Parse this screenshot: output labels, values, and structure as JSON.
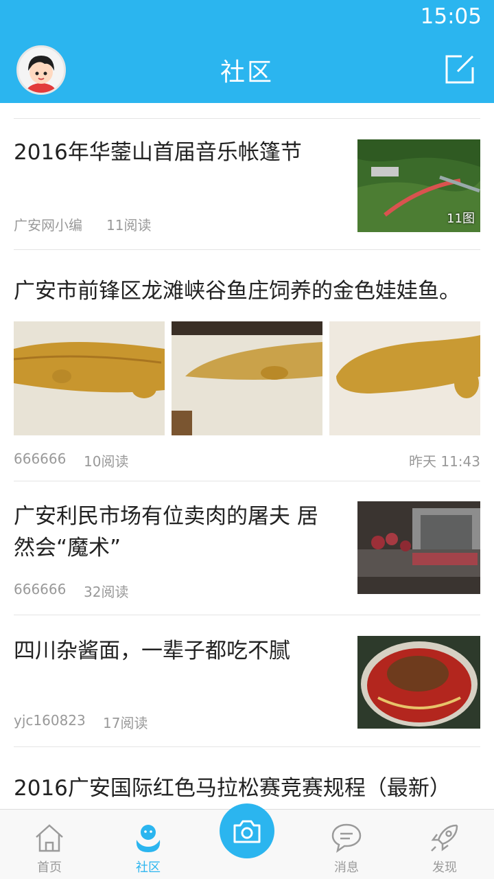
{
  "status_bar": {
    "time": "15:05"
  },
  "header": {
    "title": "社区"
  },
  "posts": [
    {
      "title": "2016年华蓥山首届音乐帐篷节",
      "author": "广安网小编",
      "reads": "11阅读",
      "image_count": "11图"
    },
    {
      "title": "广安市前锋区龙滩峡谷鱼庄饲养的金色娃娃鱼。",
      "author": "666666",
      "reads": "10阅读",
      "time": "昨天 11:43"
    },
    {
      "title_line1": "广安利民市场有位卖肉的屠夫 居",
      "title_line2": "然会“魔术”",
      "author": "666666",
      "reads": "32阅读"
    },
    {
      "title": "四川杂酱面，一辈子都吃不腻",
      "author": "yjc160823",
      "reads": "17阅读"
    },
    {
      "title": "2016广安国际红色马拉松赛竞赛规程（最新）"
    }
  ],
  "tabbar": {
    "home": "首页",
    "community": "社区",
    "messages": "消息",
    "discover": "发现"
  },
  "colors": {
    "brand": "#2bb5ef",
    "meta": "#999999"
  }
}
